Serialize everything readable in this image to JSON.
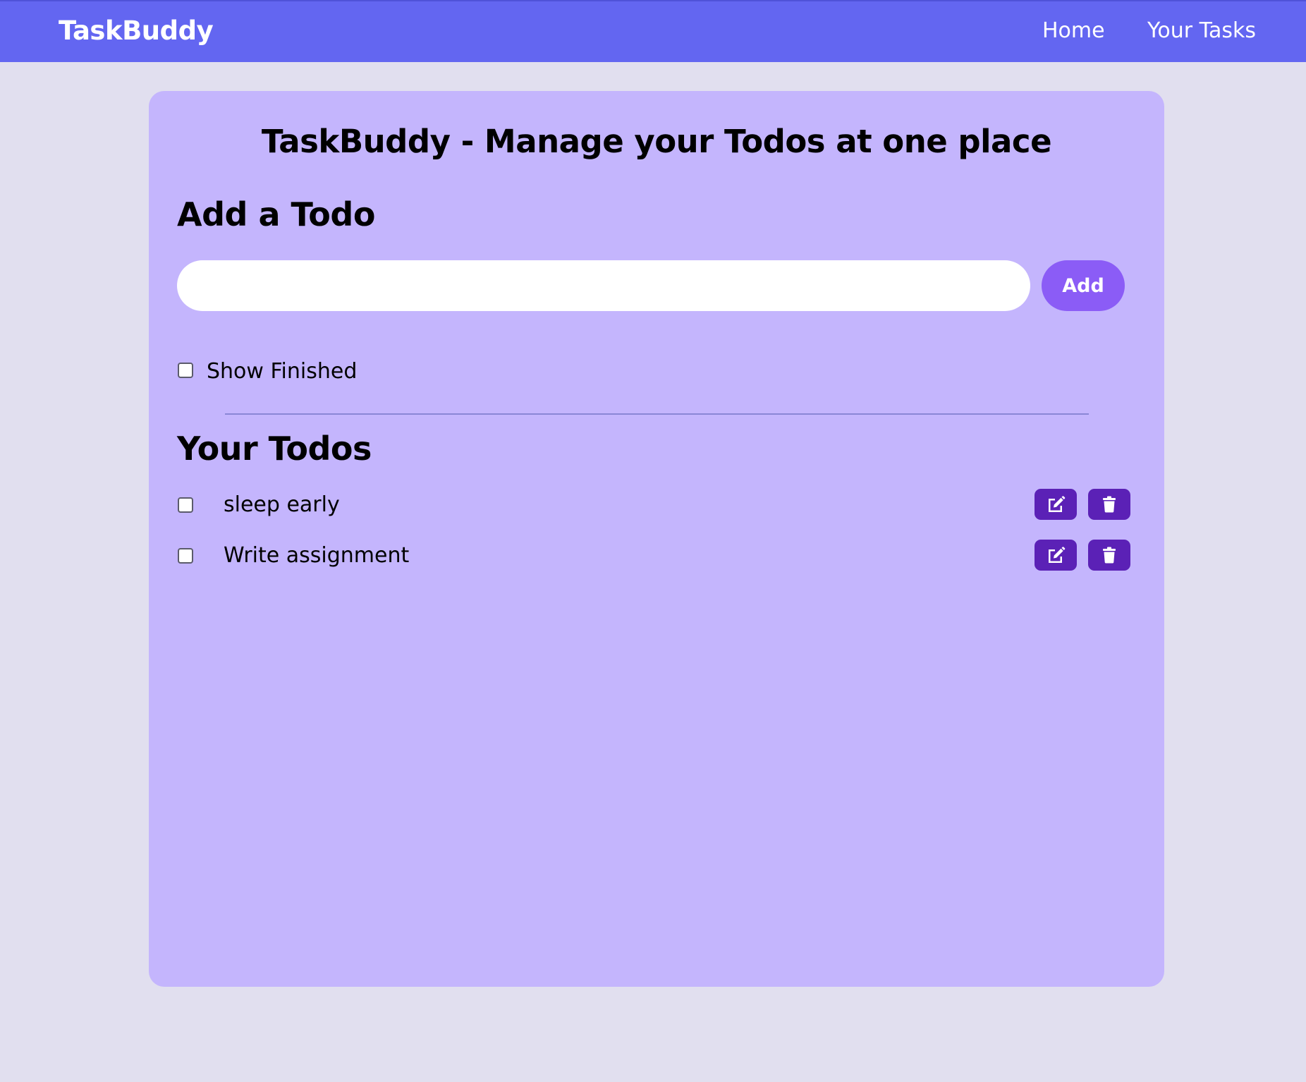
{
  "navbar": {
    "brand": "TaskBuddy",
    "links": [
      "Home",
      "Your Tasks"
    ]
  },
  "main": {
    "title": "TaskBuddy - Manage your Todos at one place",
    "add_heading": "Add a Todo",
    "input": {
      "value": "",
      "placeholder": ""
    },
    "add_button_label": "Add",
    "show_finished_label": "Show Finished",
    "show_finished_checked": false,
    "todos_heading": "Your Todos",
    "todos": [
      {
        "text": "sleep early",
        "completed": false
      },
      {
        "text": "Write assignment",
        "completed": false
      }
    ]
  },
  "icons": {
    "edit": "edit-icon",
    "delete": "trash-icon"
  },
  "colors": {
    "navbar": "#6366f1",
    "page_background": "#e1dfef",
    "card_background": "#c4b5fd",
    "add_button": "#8b5cf6",
    "action_buttons": "#5b21b6"
  }
}
